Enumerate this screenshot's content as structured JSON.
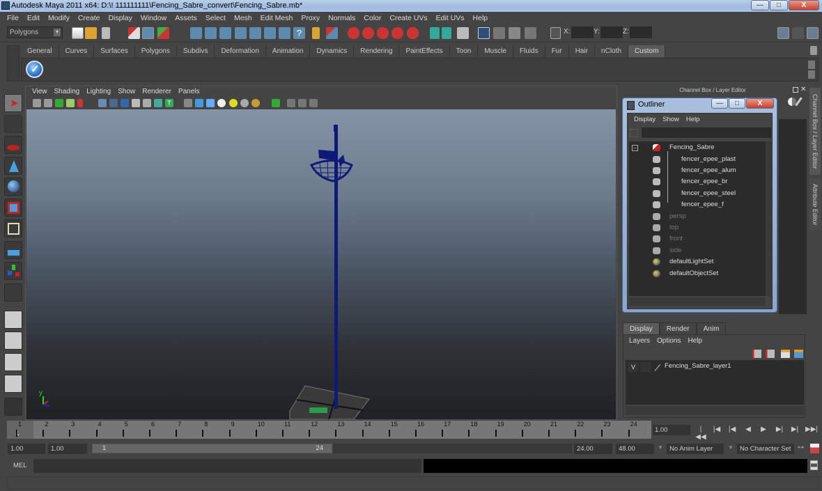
{
  "window": {
    "title": "Autodesk Maya 2011 x64: D:\\! 111111111\\Fencing_Sabre_convert\\Fencing_Sabre.mb*",
    "minimize": "—",
    "maximize": "□",
    "close": "X"
  },
  "menubar": [
    "File",
    "Edit",
    "Modify",
    "Create",
    "Display",
    "Window",
    "Assets",
    "Select",
    "Mesh",
    "Edit Mesh",
    "Proxy",
    "Normals",
    "Color",
    "Create UVs",
    "Edit UVs",
    "Help"
  ],
  "statusline": {
    "mode": "Polygons",
    "x_label": "X:",
    "y_label": "Y:",
    "z_label": "Z:",
    "x_value": "",
    "y_value": "",
    "z_value": ""
  },
  "shelf": {
    "tabs": [
      "General",
      "Curves",
      "Surfaces",
      "Polygons",
      "Subdivs",
      "Deformation",
      "Animation",
      "Dynamics",
      "Rendering",
      "PaintEffects",
      "Toon",
      "Muscle",
      "Fluids",
      "Fur",
      "Hair",
      "nCloth",
      "Custom"
    ],
    "active_tab": "Custom"
  },
  "viewport": {
    "menu": [
      "View",
      "Shading",
      "Lighting",
      "Show",
      "Renderer",
      "Panels"
    ],
    "axis_label": "y",
    "object": "Fencing_Sabre (wireframe)",
    "wire_color": "#0f1a78"
  },
  "channel_box": {
    "header": "Channel Box / Layer Editor"
  },
  "side_tabs": [
    "Channel Box / Layer Editor",
    "Attribute Editor"
  ],
  "outliner": {
    "title": "Outliner",
    "menu": [
      "Display",
      "Show",
      "Help"
    ],
    "items": [
      {
        "label": "Fencing_Sabre",
        "type": "group",
        "dim": false
      },
      {
        "label": "fencer_epee_plast",
        "type": "mesh",
        "dim": false
      },
      {
        "label": "fencer_epee_alum",
        "type": "mesh",
        "dim": false
      },
      {
        "label": "fencer_epee_br",
        "type": "mesh",
        "dim": false
      },
      {
        "label": "fencer_epee_steel",
        "type": "mesh",
        "dim": false
      },
      {
        "label": "fencer_epee_f",
        "type": "mesh",
        "dim": false
      },
      {
        "label": "persp",
        "type": "camera",
        "dim": true
      },
      {
        "label": "top",
        "type": "camera",
        "dim": true
      },
      {
        "label": "front",
        "type": "camera",
        "dim": true
      },
      {
        "label": "side",
        "type": "camera",
        "dim": true
      },
      {
        "label": "defaultLightSet",
        "type": "set",
        "dim": false
      },
      {
        "label": "defaultObjectSet",
        "type": "set",
        "dim": false
      }
    ]
  },
  "layer_editor": {
    "tabs": [
      "Display",
      "Render",
      "Anim"
    ],
    "active_tab": "Display",
    "menu": [
      "Layers",
      "Options",
      "Help"
    ],
    "layers": [
      {
        "visible": "V",
        "name": "Fencing_Sabre_layer1"
      }
    ]
  },
  "timeline": {
    "ticks": [
      "1",
      "2",
      "3",
      "4",
      "5",
      "6",
      "7",
      "8",
      "9",
      "10",
      "11",
      "12",
      "13",
      "14",
      "15",
      "16",
      "17",
      "18",
      "19",
      "20",
      "21",
      "22",
      "23",
      "24"
    ],
    "current_marker": "1",
    "current_frame": "1.00"
  },
  "range": {
    "start": "1.00",
    "playback_start": "1.00",
    "slider_start": "1",
    "slider_end": "24",
    "playback_end": "24.00",
    "end": "48.00",
    "anim_layer": "No Anim Layer",
    "character_set": "No Character Set"
  },
  "command_line": {
    "label": "MEL",
    "value": "",
    "result": ""
  },
  "help_line": ""
}
